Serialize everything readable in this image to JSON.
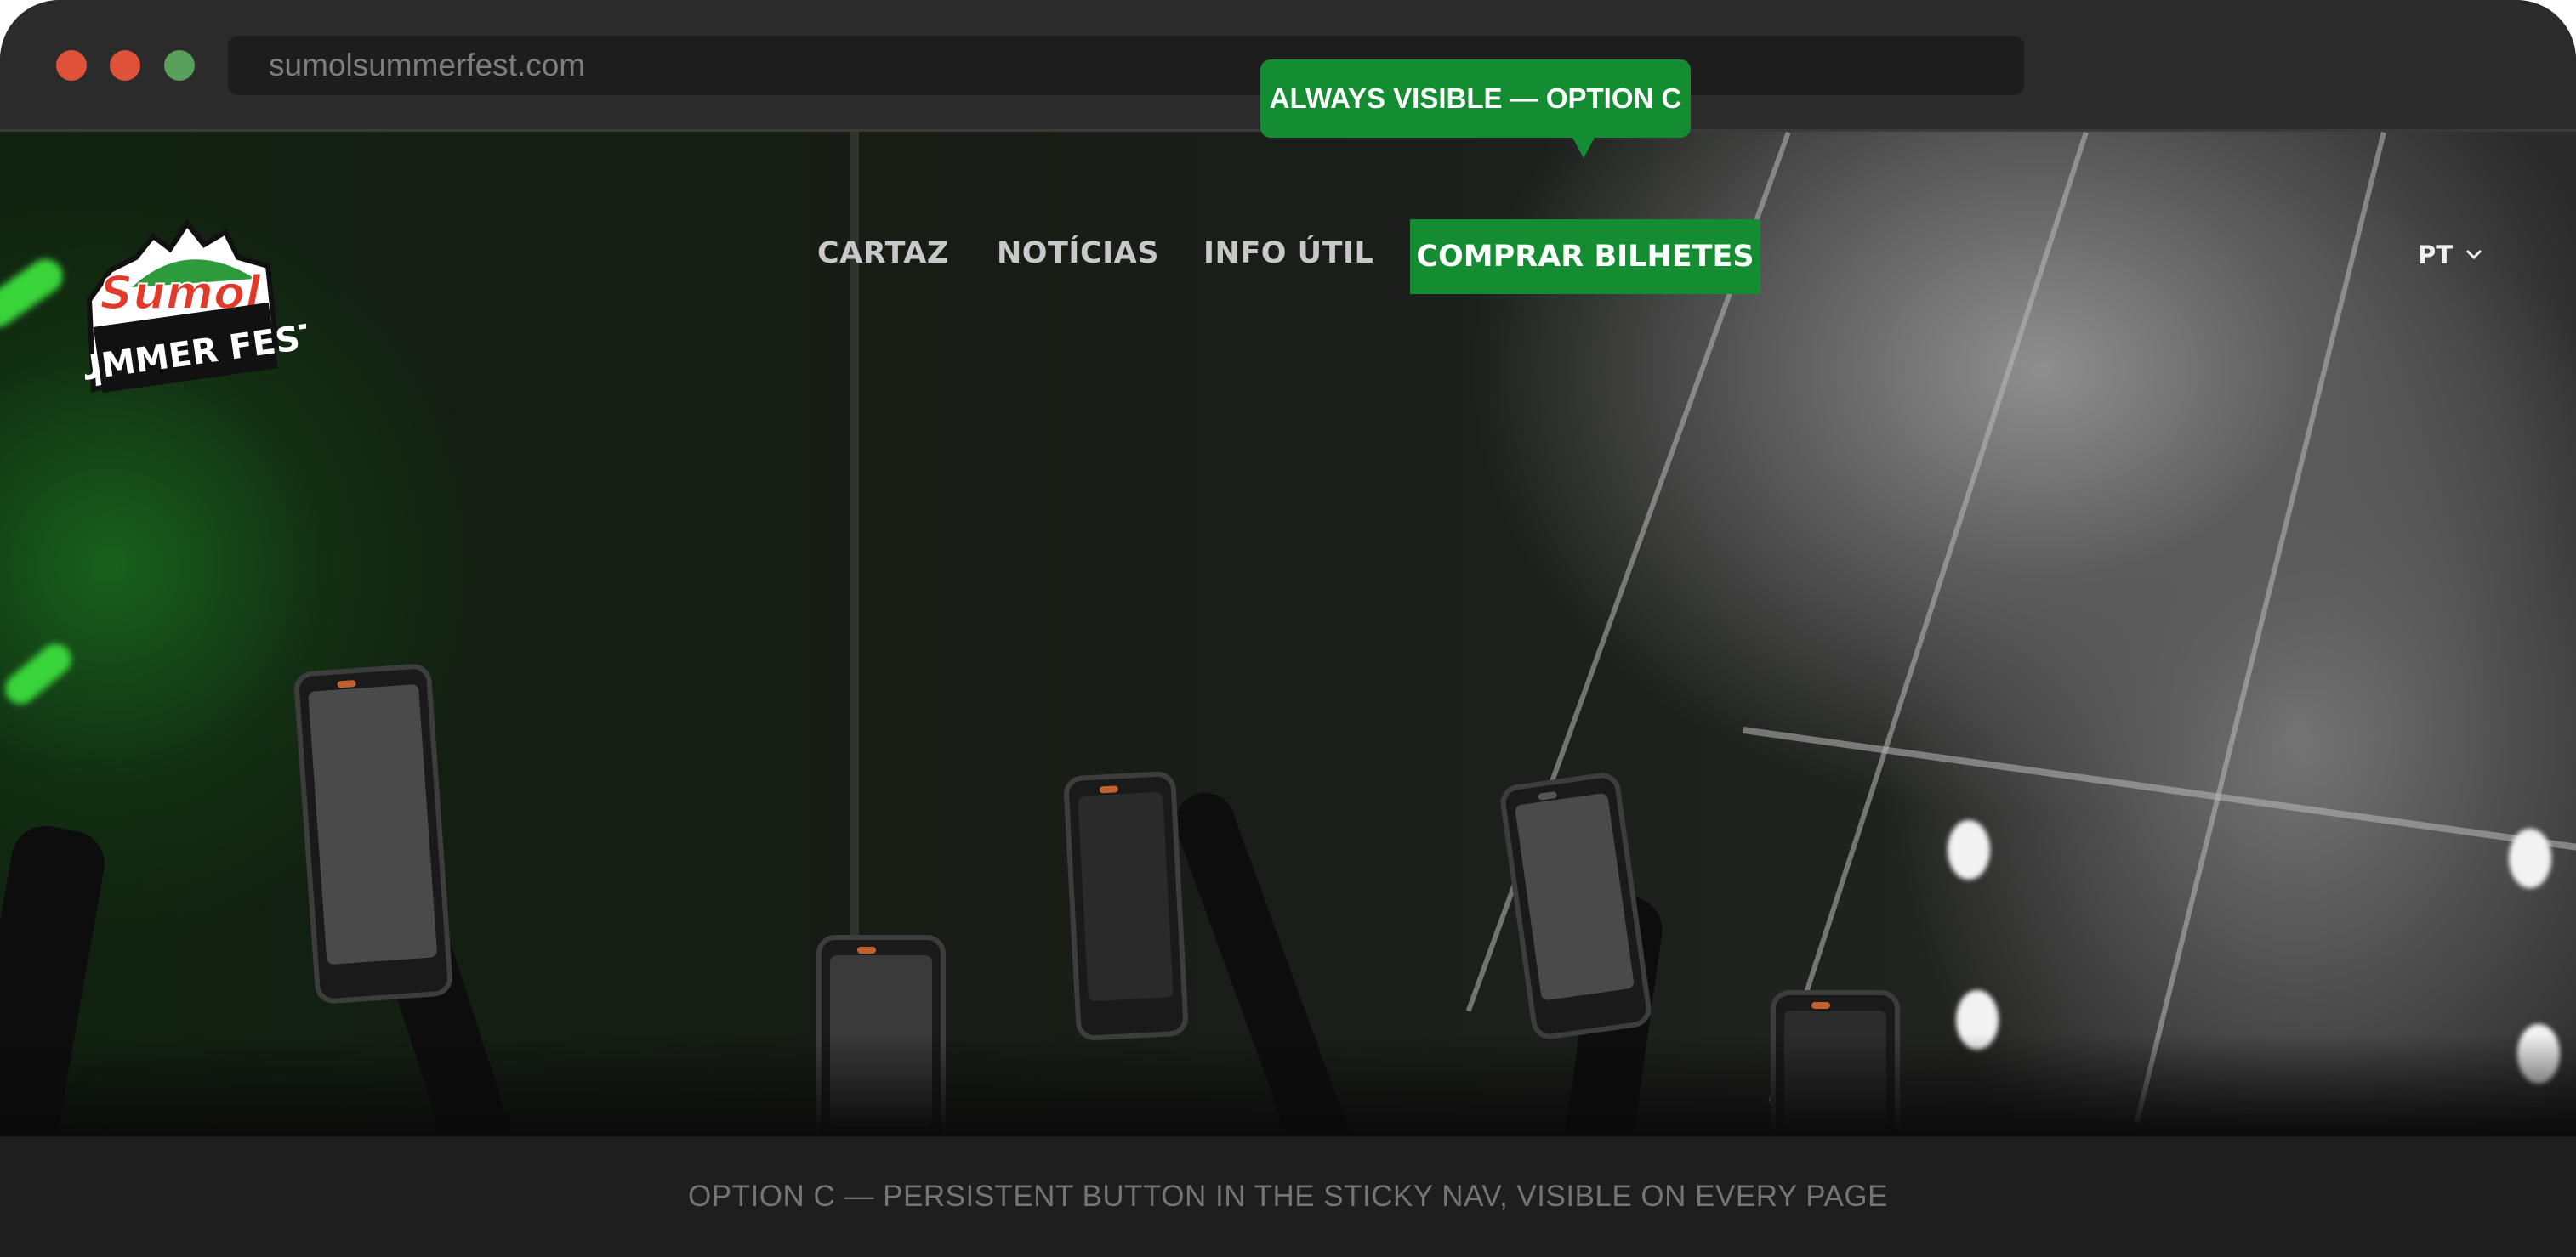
{
  "browser": {
    "url": "sumolsummerfest.com",
    "traffic_lights": [
      "close",
      "minimize",
      "maximize"
    ]
  },
  "tooltip": {
    "label": "ALWAYS VISIBLE — OPTION C"
  },
  "site": {
    "logo": {
      "brand": "Sumol",
      "subtitle": "SUMMER FEST"
    },
    "nav": {
      "items": [
        {
          "label": "CARTAZ"
        },
        {
          "label": "NOTÍCIAS"
        },
        {
          "label": "INFO ÚTIL"
        }
      ],
      "cta_label": "COMPRAR BILHETES",
      "language": "PT",
      "language_icon": "chevron-down-icon"
    }
  },
  "caption": "OPTION C — PERSISTENT BUTTON IN THE STICKY NAV, VISIBLE ON EVERY PAGE",
  "colors": {
    "brand_green": "#148c32",
    "chrome_bg": "#2b2b2b",
    "close_dot": "#e0513a",
    "maximize_dot": "#58a05a"
  }
}
